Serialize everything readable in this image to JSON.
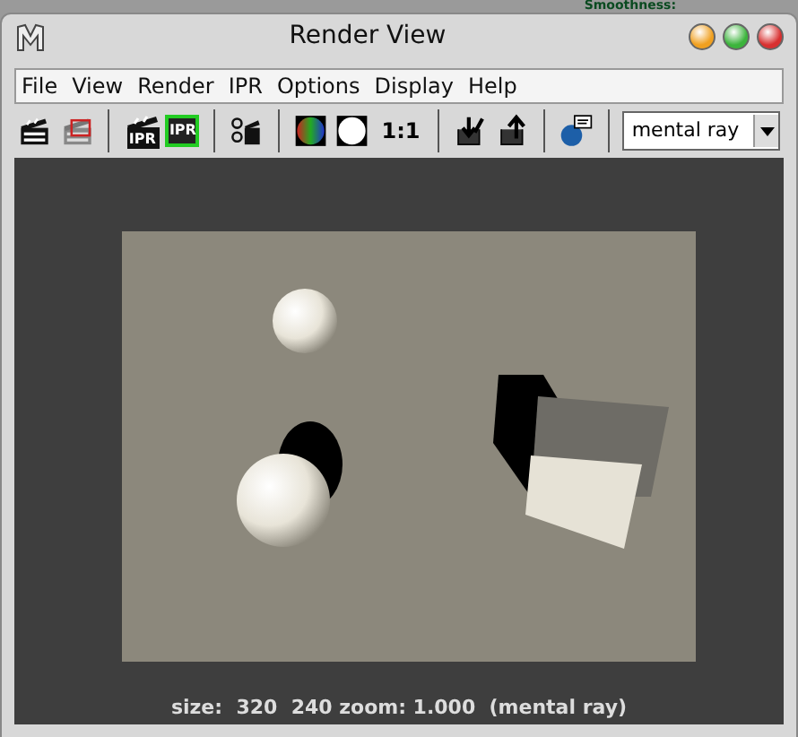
{
  "background": {
    "label": "Smoothness:"
  },
  "window": {
    "title": "Render View"
  },
  "menu": [
    "File",
    "View",
    "Render",
    "IPR",
    "Options",
    "Display",
    "Help"
  ],
  "toolbar": [
    {
      "kind": "clapper"
    },
    {
      "kind": "clapper-redo"
    },
    {
      "kind": "sep"
    },
    {
      "kind": "clapper-ipr",
      "label": "IPR"
    },
    {
      "kind": "ipr",
      "label": "IPR"
    },
    {
      "kind": "sep"
    },
    {
      "kind": "clapper-options"
    },
    {
      "kind": "sep"
    },
    {
      "kind": "rgb"
    },
    {
      "kind": "alpha"
    },
    {
      "kind": "text",
      "label": "1:1"
    },
    {
      "kind": "sep"
    },
    {
      "kind": "keep"
    },
    {
      "kind": "remove"
    },
    {
      "kind": "sep"
    },
    {
      "kind": "log"
    },
    {
      "kind": "sep"
    }
  ],
  "renderer": {
    "value": "mental ray"
  },
  "status": "size:  320  240 zoom: 1.000  (mental ray)"
}
